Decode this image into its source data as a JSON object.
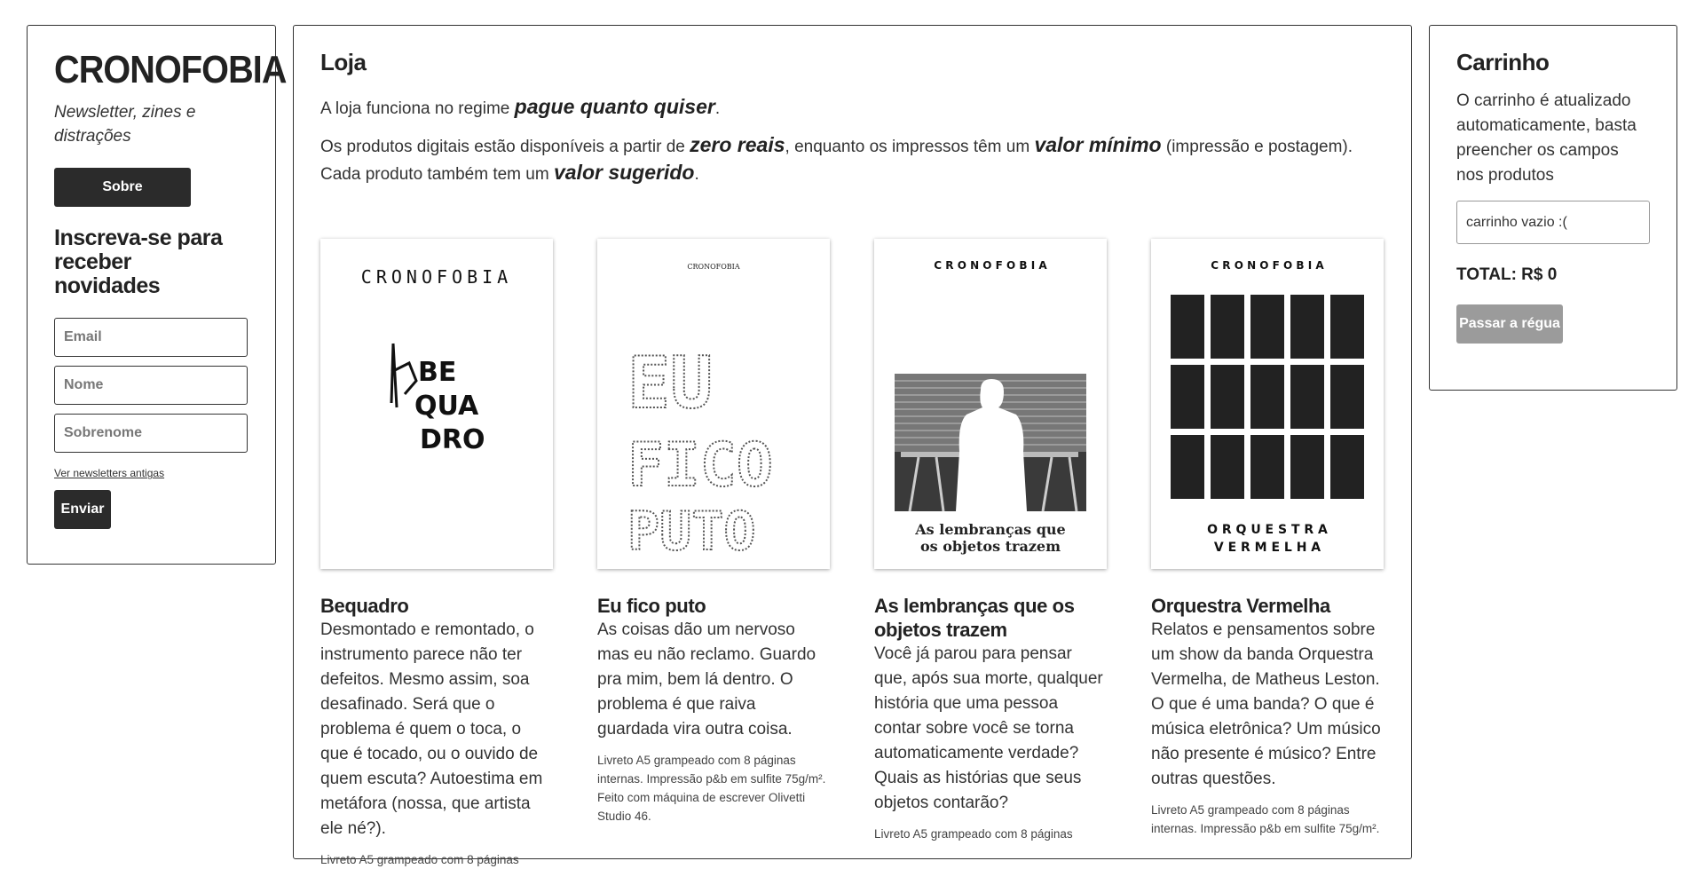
{
  "sidebar": {
    "brand": "CRONOFOBIA",
    "tagline": "Newsletter, zines e distrações",
    "about_label": "Sobre",
    "subscribe_title": "Inscreva-se para receber novidades",
    "email_placeholder": "Email",
    "name_placeholder": "Nome",
    "surname_placeholder": "Sobrenome",
    "old_newsletters_link": "Ver newsletters antigas",
    "send_label": "Enviar"
  },
  "shop": {
    "title": "Loja",
    "intro1_before": "A loja funciona no regime ",
    "intro1_em": "pague quanto quiser",
    "intro1_after": ".",
    "intro2_a": "Os produtos digitais estão disponíveis a partir de ",
    "intro2_b": "zero reais",
    "intro2_c": ", enquanto os impressos têm um ",
    "intro2_d": "valor mínimo",
    "intro2_e": " (impressão e postagem). Cada produto também tem um ",
    "intro2_f": "valor sugerido",
    "intro2_g": ".",
    "products": [
      {
        "cover_brand": "CRONOFOBIA",
        "cover_art": [
          "BE",
          "QUA",
          "DRO"
        ],
        "title": "Bequadro",
        "description": "Desmontado e remontado, o instrumento parece não ter defeitos. Mesmo assim, soa desafinado. Será que o problema é quem o toca, o que é tocado, ou o ouvido de quem escuta? Autoestima em metáfora (nossa, que artista ele né?).",
        "spec": "Livreto A5 grampeado com 8 páginas"
      },
      {
        "cover_brand": "CRONOFOBIA",
        "cover_art": [
          "EU",
          "FICO",
          "PUTO"
        ],
        "title": "Eu fico puto",
        "description": "As coisas dão um nervoso mas eu não reclamo. Guardo pra mim, bem lá dentro. O problema é que raiva guardada vira outra coisa.",
        "spec": "Livreto A5 grampeado com 8 páginas internas. Impressão p&b em sulfite 75g/m². Feito com máquina de escrever Olivetti Studio 46."
      },
      {
        "cover_brand": "C R O N O F O B I A",
        "cover_art": [
          "As lembranças que",
          "os objetos trazem"
        ],
        "title": "As lembranças que os objetos trazem",
        "description": "Você já parou para pensar que, após sua morte, qualquer história que uma pessoa contar sobre você se torna automaticamente verdade? Quais as histórias que seus objetos contarão?",
        "spec": "Livreto A5 grampeado com 8 páginas"
      },
      {
        "cover_brand": "C R O N O F O B I A",
        "cover_art": [
          "O R Q U E S T R A",
          "V E R M E L H A"
        ],
        "title": "Orquestra Vermelha",
        "description": "Relatos e pensamentos sobre um show da banda Orquestra Vermelha, de Matheus Leston. O que é uma banda? O que é música eletrônica? Um músico não presente é músico? Entre outras questões.",
        "spec": "Livreto A5 grampeado com 8 páginas internas. Impressão p&b em sulfite 75g/m²."
      }
    ]
  },
  "cart": {
    "title": "Carrinho",
    "info": "O carrinho é atualizado automaticamente, basta preencher os campos nos produtos",
    "empty_text": "carrinho vazio :(",
    "total": "TOTAL: R$ 0",
    "checkout_label": "Passar a régua"
  },
  "colors": {
    "text": "#333333",
    "dark_button": "#2b2b2b",
    "disabled_button": "#9b9b9b"
  }
}
